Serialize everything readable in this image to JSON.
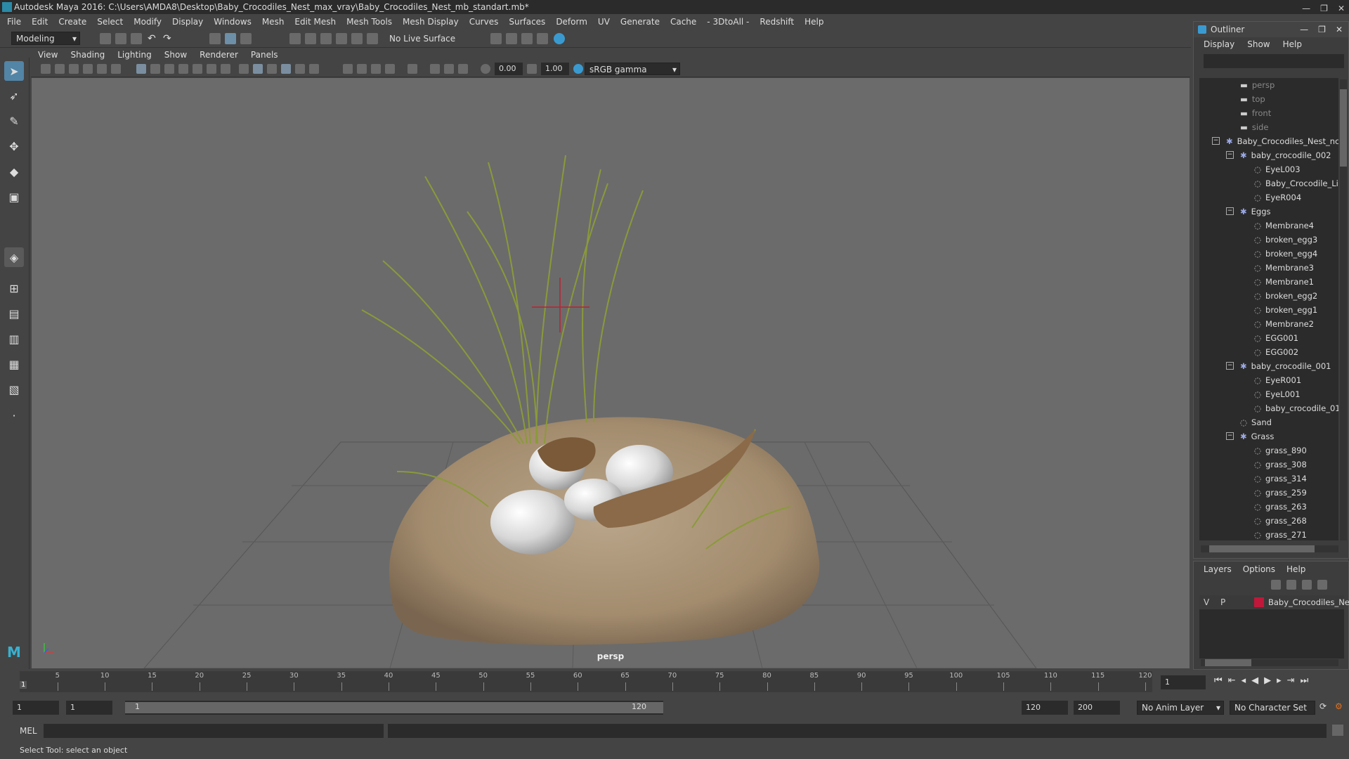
{
  "window": {
    "title": "Autodesk Maya 2016: C:\\Users\\AMDA8\\Desktop\\Baby_Crocodiles_Nest_max_vray\\Baby_Crocodiles_Nest_mb_standart.mb*"
  },
  "menubar": {
    "items": [
      "File",
      "Edit",
      "Create",
      "Select",
      "Modify",
      "Display",
      "Windows",
      "Mesh",
      "Edit Mesh",
      "Mesh Tools",
      "Mesh Display",
      "Curves",
      "Surfaces",
      "Deform",
      "UV",
      "Generate",
      "Cache",
      "- 3DtoAll -",
      "Redshift",
      "Help"
    ]
  },
  "shelf": {
    "mode": "Modeling",
    "live_surface": "No Live Surface"
  },
  "panel": {
    "menu": [
      "View",
      "Shading",
      "Lighting",
      "Show",
      "Renderer",
      "Panels"
    ],
    "exposure": "0.00",
    "gamma": "1.00",
    "color_space": "sRGB gamma",
    "camera_label": "persp"
  },
  "outliner": {
    "title": "Outliner",
    "menu": [
      "Display",
      "Show",
      "Help"
    ],
    "rows": [
      {
        "label": "persp",
        "depth": 2,
        "icon": "camera-icon",
        "dim": true,
        "expander": ""
      },
      {
        "label": "top",
        "depth": 2,
        "icon": "camera-icon",
        "dim": true,
        "expander": ""
      },
      {
        "label": "front",
        "depth": 2,
        "icon": "camera-icon",
        "dim": true,
        "expander": ""
      },
      {
        "label": "side",
        "depth": 2,
        "icon": "camera-icon",
        "dim": true,
        "expander": ""
      },
      {
        "label": "Baby_Crocodiles_Nest_ncl",
        "depth": 1,
        "icon": "group-icon",
        "dim": false,
        "expander": "−"
      },
      {
        "label": "baby_crocodile_002",
        "depth": 2,
        "icon": "group-icon",
        "dim": false,
        "expander": "−"
      },
      {
        "label": "EyeL003",
        "depth": 3,
        "icon": "mesh-icon",
        "dim": false,
        "expander": ""
      },
      {
        "label": "Baby_Crocodile_Li",
        "depth": 3,
        "icon": "mesh-icon",
        "dim": false,
        "expander": ""
      },
      {
        "label": "EyeR004",
        "depth": 3,
        "icon": "mesh-icon",
        "dim": false,
        "expander": ""
      },
      {
        "label": "Eggs",
        "depth": 2,
        "icon": "group-icon",
        "dim": false,
        "expander": "−"
      },
      {
        "label": "Membrane4",
        "depth": 3,
        "icon": "mesh-icon",
        "dim": false,
        "expander": ""
      },
      {
        "label": "broken_egg3",
        "depth": 3,
        "icon": "mesh-icon",
        "dim": false,
        "expander": ""
      },
      {
        "label": "broken_egg4",
        "depth": 3,
        "icon": "mesh-icon",
        "dim": false,
        "expander": ""
      },
      {
        "label": "Membrane3",
        "depth": 3,
        "icon": "mesh-icon",
        "dim": false,
        "expander": ""
      },
      {
        "label": "Membrane1",
        "depth": 3,
        "icon": "mesh-icon",
        "dim": false,
        "expander": ""
      },
      {
        "label": "broken_egg2",
        "depth": 3,
        "icon": "mesh-icon",
        "dim": false,
        "expander": ""
      },
      {
        "label": "broken_egg1",
        "depth": 3,
        "icon": "mesh-icon",
        "dim": false,
        "expander": ""
      },
      {
        "label": "Membrane2",
        "depth": 3,
        "icon": "mesh-icon",
        "dim": false,
        "expander": ""
      },
      {
        "label": "EGG001",
        "depth": 3,
        "icon": "mesh-icon",
        "dim": false,
        "expander": ""
      },
      {
        "label": "EGG002",
        "depth": 3,
        "icon": "mesh-icon",
        "dim": false,
        "expander": ""
      },
      {
        "label": "baby_crocodile_001",
        "depth": 2,
        "icon": "group-icon",
        "dim": false,
        "expander": "−"
      },
      {
        "label": "EyeR001",
        "depth": 3,
        "icon": "mesh-icon",
        "dim": false,
        "expander": ""
      },
      {
        "label": "EyeL001",
        "depth": 3,
        "icon": "mesh-icon",
        "dim": false,
        "expander": ""
      },
      {
        "label": "baby_crocodile_01",
        "depth": 3,
        "icon": "mesh-icon",
        "dim": false,
        "expander": ""
      },
      {
        "label": "Sand",
        "depth": 2,
        "icon": "mesh-icon",
        "dim": false,
        "expander": ""
      },
      {
        "label": "Grass",
        "depth": 2,
        "icon": "group-icon",
        "dim": false,
        "expander": "−"
      },
      {
        "label": "grass_890",
        "depth": 3,
        "icon": "mesh-icon",
        "dim": false,
        "expander": ""
      },
      {
        "label": "grass_308",
        "depth": 3,
        "icon": "mesh-icon",
        "dim": false,
        "expander": ""
      },
      {
        "label": "grass_314",
        "depth": 3,
        "icon": "mesh-icon",
        "dim": false,
        "expander": ""
      },
      {
        "label": "grass_259",
        "depth": 3,
        "icon": "mesh-icon",
        "dim": false,
        "expander": ""
      },
      {
        "label": "grass_263",
        "depth": 3,
        "icon": "mesh-icon",
        "dim": false,
        "expander": ""
      },
      {
        "label": "grass_268",
        "depth": 3,
        "icon": "mesh-icon",
        "dim": false,
        "expander": ""
      },
      {
        "label": "grass_271",
        "depth": 3,
        "icon": "mesh-icon",
        "dim": false,
        "expander": ""
      }
    ]
  },
  "layers": {
    "menu": [
      "Layers",
      "Options",
      "Help"
    ],
    "row": {
      "v": "V",
      "p": "P",
      "name": "Baby_Crocodiles_Nest",
      "color": "#c0183a"
    }
  },
  "timeline": {
    "ticks": [
      "5",
      "10",
      "15",
      "20",
      "25",
      "30",
      "35",
      "40",
      "45",
      "50",
      "55",
      "60",
      "65",
      "70",
      "75",
      "80",
      "85",
      "90",
      "95",
      "100",
      "105",
      "110",
      "115",
      "120"
    ],
    "current_frame": "1",
    "start_marker": "1"
  },
  "range": {
    "start": "1",
    "playback_start": "1",
    "range_start_label": "1",
    "range_end_label": "120",
    "playback_end": "120",
    "end": "200",
    "anim_layer": "No Anim Layer",
    "character_set": "No Character Set"
  },
  "command": {
    "label": "MEL"
  },
  "help": {
    "text": "Select Tool: select an object"
  },
  "colors": {
    "accent": "#2a8aa8",
    "viewport": "#6b6b6b",
    "panel": "#444444"
  }
}
